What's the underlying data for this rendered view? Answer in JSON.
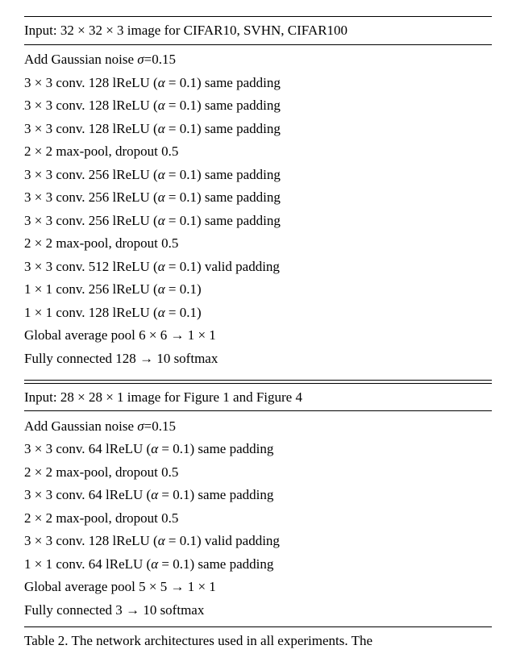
{
  "table1": {
    "header": "Input: 32 × 32 × 3 image for CIFAR10, SVHN, CIFAR100",
    "rows": [
      "Add Gaussian noise σ=0.15",
      "3 × 3 conv. 128 lReLU (α = 0.1) same padding",
      "3 × 3 conv. 128 lReLU (α = 0.1) same padding",
      "3 × 3 conv. 128 lReLU (α = 0.1) same padding",
      "2 × 2 max-pool, dropout 0.5",
      "3 × 3 conv. 256 lReLU (α = 0.1) same padding",
      "3 × 3 conv. 256 lReLU (α = 0.1) same padding",
      "3 × 3 conv. 256 lReLU (α = 0.1) same padding",
      "2 × 2 max-pool, dropout 0.5",
      "3 × 3 conv. 512 lReLU (α = 0.1) valid padding",
      "1 × 1 conv. 256 lReLU (α = 0.1)",
      "1 × 1 conv. 128 lReLU (α = 0.1)",
      "Global average pool 6 × 6 → 1 × 1",
      "Fully connected 128 → 10 softmax"
    ]
  },
  "table2": {
    "header": "Input: 28 × 28 × 1 image for Figure 1 and Figure 4",
    "rows": [
      "Add Gaussian noise σ=0.15",
      "3 × 3 conv. 64 lReLU (α = 0.1) same padding",
      "2 × 2 max-pool, dropout 0.5",
      "3 × 3 conv. 64 lReLU (α = 0.1) same padding",
      "2 × 2 max-pool, dropout 0.5",
      "3 × 3 conv. 128 lReLU (α = 0.1) valid padding",
      "1 × 1 conv. 64 lReLU (α = 0.1) same padding",
      "Global average pool 5 × 5 → 1 × 1",
      "Fully connected 3 → 10 softmax"
    ]
  },
  "caption": "Table 2. The network architectures used in all experiments. The"
}
